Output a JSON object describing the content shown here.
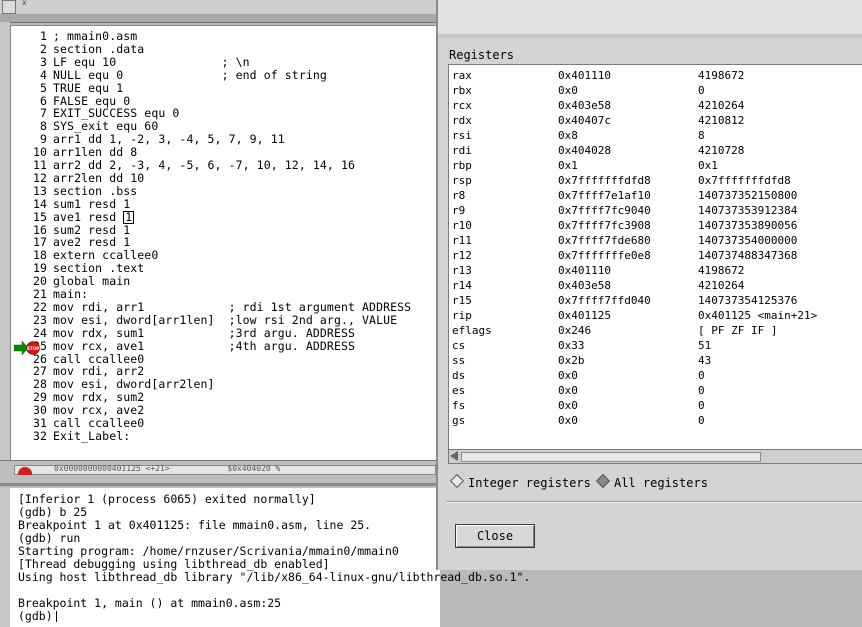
{
  "top_strip": {
    "close_glyph": "x"
  },
  "source": {
    "lines": [
      {
        "n": "1",
        "code": "; mmain0.asm"
      },
      {
        "n": "2",
        "code": "section .data"
      },
      {
        "n": "3",
        "code": "LF equ 10               ; \\n"
      },
      {
        "n": "4",
        "code": "NULL equ 0              ; end of string"
      },
      {
        "n": "5",
        "code": "TRUE equ 1"
      },
      {
        "n": "6",
        "code": "FALSE equ 0"
      },
      {
        "n": "7",
        "code": "EXIT_SUCCESS equ 0"
      },
      {
        "n": "8",
        "code": "SYS_exit equ 60"
      },
      {
        "n": "9",
        "code": "arr1 dd 1, -2, 3, -4, 5, 7, 9, 11"
      },
      {
        "n": "10",
        "code": "arr1len dd 8"
      },
      {
        "n": "11",
        "code": "arr2 dd 2, -3, 4, -5, 6, -7, 10, 12, 14, 16"
      },
      {
        "n": "12",
        "code": "arr2len dd 10"
      },
      {
        "n": "13",
        "code": "section .bss"
      },
      {
        "n": "14",
        "code": "sum1 resd 1"
      },
      {
        "n": "15",
        "code_pre": "ave1 resd ",
        "code_cursor": "1"
      },
      {
        "n": "16",
        "code": "sum2 resd 1"
      },
      {
        "n": "17",
        "code": "ave2 resd 1"
      },
      {
        "n": "18",
        "code": "extern ccallee0"
      },
      {
        "n": "19",
        "code": "section .text"
      },
      {
        "n": "20",
        "code": "global main"
      },
      {
        "n": "21",
        "code": "main:"
      },
      {
        "n": "22",
        "code": "mov rdi, arr1            ; rdi 1st argument ADDRESS"
      },
      {
        "n": "23",
        "code": "mov esi, dword[arr1len]  ;low rsi 2nd arg., VALUE"
      },
      {
        "n": "24",
        "code": "mov rdx, sum1            ;3rd argu. ADDRESS"
      },
      {
        "n": "25",
        "code": "mov rcx, ave1            ;4th argu. ADDRESS"
      },
      {
        "n": "26",
        "code": "call ccallee0"
      },
      {
        "n": "27",
        "code": "mov rdi, arr2"
      },
      {
        "n": "28",
        "code": "mov esi, dword[arr2len]"
      },
      {
        "n": "29",
        "code": "mov rdx, sum2"
      },
      {
        "n": "30",
        "code": "mov rcx, ave2"
      },
      {
        "n": "31",
        "code": "call ccallee0"
      },
      {
        "n": "32",
        "code": "Exit_Label:"
      }
    ],
    "breakpoint_line": 25,
    "breakpoint_label": "STOP"
  },
  "mini_bar_text": "0x0000000000401125 <+21>            $0x404020 %",
  "console": {
    "lines": [
      "[Inferior 1 (process 6065) exited normally]",
      "(gdb) b 25",
      "Breakpoint 1 at 0x401125: file mmain0.asm, line 25.",
      "(gdb) run",
      "Starting program: /home/rnzuser/Scrivania/mmain0/mmain0",
      "[Thread debugging using libthread_db enabled]",
      "Using host libthread_db library \"/lib/x86_64-linux-gnu/libthread_db.so.1\".",
      "",
      "Breakpoint 1, main () at mmain0.asm:25",
      "(gdb)"
    ]
  },
  "registers": {
    "heading": "Registers",
    "rows": [
      {
        "name": "rax",
        "hex": "0x401110",
        "val": "4198672"
      },
      {
        "name": "rbx",
        "hex": "0x0",
        "val": "0"
      },
      {
        "name": "rcx",
        "hex": "0x403e58",
        "val": "4210264"
      },
      {
        "name": "rdx",
        "hex": "0x40407c",
        "val": "4210812"
      },
      {
        "name": "rsi",
        "hex": "0x8",
        "val": "8"
      },
      {
        "name": "rdi",
        "hex": "0x404028",
        "val": "4210728"
      },
      {
        "name": "rbp",
        "hex": "0x1",
        "val": "0x1"
      },
      {
        "name": "rsp",
        "hex": "0x7fffffffdfd8",
        "val": "0x7fffffffdfd8"
      },
      {
        "name": "r8",
        "hex": "0x7ffff7e1af10",
        "val": "140737352150800"
      },
      {
        "name": "r9",
        "hex": "0x7ffff7fc9040",
        "val": "140737353912384"
      },
      {
        "name": "r10",
        "hex": "0x7ffff7fc3908",
        "val": "140737353890056"
      },
      {
        "name": "r11",
        "hex": "0x7ffff7fde680",
        "val": "140737354000000"
      },
      {
        "name": "r12",
        "hex": "0x7fffffffe0e8",
        "val": "140737488347368"
      },
      {
        "name": "r13",
        "hex": "0x401110",
        "val": "4198672"
      },
      {
        "name": "r14",
        "hex": "0x403e58",
        "val": "4210264"
      },
      {
        "name": "r15",
        "hex": "0x7ffff7ffd040",
        "val": "140737354125376"
      },
      {
        "name": "rip",
        "hex": "0x401125",
        "val": "0x401125 <main+21>"
      },
      {
        "name": "eflags",
        "hex": "0x246",
        "val": "[ PF ZF IF ]"
      },
      {
        "name": "cs",
        "hex": "0x33",
        "val": "51"
      },
      {
        "name": "ss",
        "hex": "0x2b",
        "val": "43"
      },
      {
        "name": "ds",
        "hex": "0x0",
        "val": "0"
      },
      {
        "name": "es",
        "hex": "0x0",
        "val": "0"
      },
      {
        "name": "fs",
        "hex": "0x0",
        "val": "0"
      },
      {
        "name": "gs",
        "hex": "0x0",
        "val": "0"
      }
    ],
    "radio_integer": "Integer registers",
    "radio_all": "All registers",
    "selected": "all",
    "close_label": "Close"
  }
}
